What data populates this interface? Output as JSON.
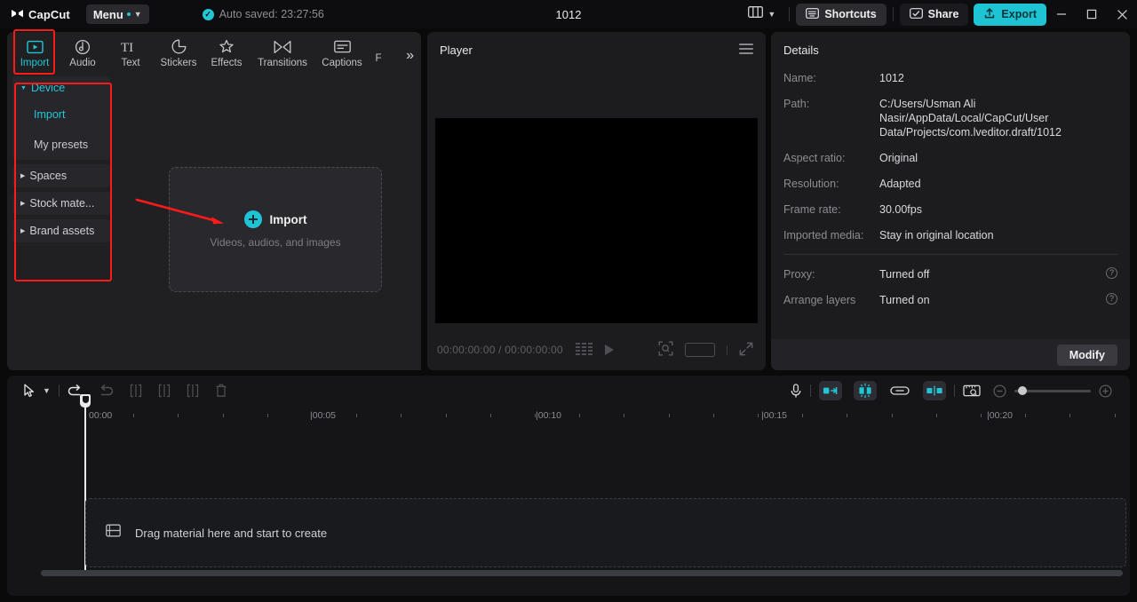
{
  "titlebar": {
    "brand": "CapCut",
    "menu_label": "Menu",
    "autosave": "Auto saved: 23:27:56",
    "project_title": "1012",
    "layout_icon": "layout-grid-icon",
    "shortcuts_label": "Shortcuts",
    "share_label": "Share",
    "export_label": "Export",
    "minimize": "–",
    "maximize": "□",
    "close": "✕"
  },
  "library": {
    "tabs": [
      {
        "label": "Import",
        "icon": "import-icon",
        "active": true
      },
      {
        "label": "Audio",
        "icon": "audio-note-icon",
        "active": false
      },
      {
        "label": "Text",
        "icon": "text-ti-icon",
        "active": false
      },
      {
        "label": "Stickers",
        "icon": "sticker-icon",
        "active": false
      },
      {
        "label": "Effects",
        "icon": "effects-sparkle-icon",
        "active": false
      },
      {
        "label": "Transitions",
        "icon": "transitions-icon",
        "active": false
      },
      {
        "label": "Captions",
        "icon": "captions-icon",
        "active": false
      },
      {
        "label": "F",
        "icon": "filters-icon",
        "active": false
      }
    ],
    "more_tabs_icon": "chevron-double-right-icon",
    "sidebar": [
      {
        "label": "Device",
        "expanded": true,
        "selected": true
      },
      {
        "label": "Import",
        "child": true,
        "selected": true
      },
      {
        "label": "My presets",
        "child": true,
        "selected": false
      },
      {
        "label": "Spaces",
        "expanded": false,
        "selected": false
      },
      {
        "label": "Stock mate...",
        "expanded": false,
        "selected": false
      },
      {
        "label": "Brand assets",
        "expanded": false,
        "selected": false
      }
    ],
    "dropzone": {
      "button_label": "Import",
      "hint": "Videos, audios, and images",
      "plus_icon": "plus-circle-icon"
    }
  },
  "player": {
    "title": "Player",
    "menu_icon": "hamburger-icon",
    "current_time": "00:00:00:00",
    "total_time": "00:00:00:00",
    "time_display": "00:00:00:00 / 00:00:00:00",
    "icons": {
      "quality": "quality-bars-icon",
      "play": "play-icon",
      "zoom_fit": "zoom-fit-icon",
      "ratio": "aspect-ratio-icon",
      "fullscreen": "fullscreen-icon"
    }
  },
  "details": {
    "title": "Details",
    "rows": [
      {
        "key": "Name:",
        "value": "1012"
      },
      {
        "key": "Path:",
        "value": "C:/Users/Usman Ali Nasir/AppData/Local/CapCut/User Data/Projects/com.lveditor.draft/1012"
      },
      {
        "key": "Aspect ratio:",
        "value": "Original"
      },
      {
        "key": "Resolution:",
        "value": "Adapted"
      },
      {
        "key": "Frame rate:",
        "value": "30.00fps"
      },
      {
        "key": "Imported media:",
        "value": "Stay in original location"
      }
    ],
    "rows2": [
      {
        "key": "Proxy:",
        "value": "Turned off",
        "help": true
      },
      {
        "key": "Arrange layers",
        "value": "Turned on",
        "help": true
      }
    ],
    "modify_label": "Modify",
    "help_icon": "question-circle-icon"
  },
  "timeline": {
    "toolbar": {
      "select_icon": "cursor-arrow-icon",
      "select_chevron": "chevron-down-icon",
      "undo_icon": "undo-icon",
      "redo_icon": "redo-icon",
      "split_icon": "split-icon",
      "trim_left_icon": "trim-left-icon",
      "trim_right_icon": "trim-right-icon",
      "delete_icon": "trash-icon",
      "mic_icon": "microphone-icon",
      "auto_cut_icon": "auto-cut-icon",
      "retouch_icon": "retouch-sparkle-icon",
      "link_icon": "link-icon",
      "mirror_icon": "mirror-split-icon",
      "snapshot_icon": "ruler-snapshot-icon",
      "zoom_out_icon": "zoom-out-icon",
      "zoom_in_icon": "zoom-in-icon"
    },
    "ruler_labels": [
      "00:00",
      "|00:05",
      "|00:10",
      "|00:15",
      "|00:20"
    ],
    "ruler_positions": [
      92,
      343,
      597,
      851,
      1105
    ],
    "playhead_position": "00:00",
    "drop_hint": "Drag material here and start to create",
    "drop_icon": "film-strip-icon"
  },
  "annotations": {
    "highlight_color": "#ff1a1a",
    "boxes": [
      "import-tab",
      "device-sidebar"
    ],
    "arrow_target": "import-dropzone"
  }
}
